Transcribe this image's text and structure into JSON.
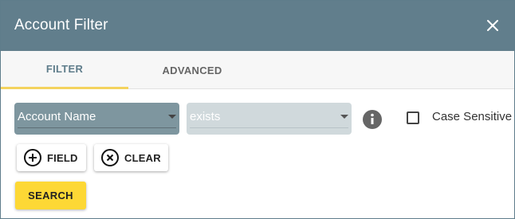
{
  "dialog": {
    "title": "Account Filter",
    "close_icon": "close-icon"
  },
  "tabs": [
    {
      "label": "FILTER",
      "active": true
    },
    {
      "label": "ADVANCED",
      "active": false
    }
  ],
  "filter_row": {
    "field_select": {
      "value": "Account Name"
    },
    "operator_select": {
      "value": "exists"
    },
    "info_icon": "info-icon",
    "case_sensitive": {
      "label": "Case Sensitive",
      "checked": false
    }
  },
  "buttons": {
    "add_field": {
      "label": "FIELD",
      "icon": "add-circle-icon"
    },
    "clear": {
      "label": "CLEAR",
      "icon": "clear-circle-icon"
    },
    "search": {
      "label": "SEARCH"
    }
  },
  "colors": {
    "header": "#617e8c",
    "tab_indicator": "#f4d35e",
    "search_button": "#fdd835"
  }
}
